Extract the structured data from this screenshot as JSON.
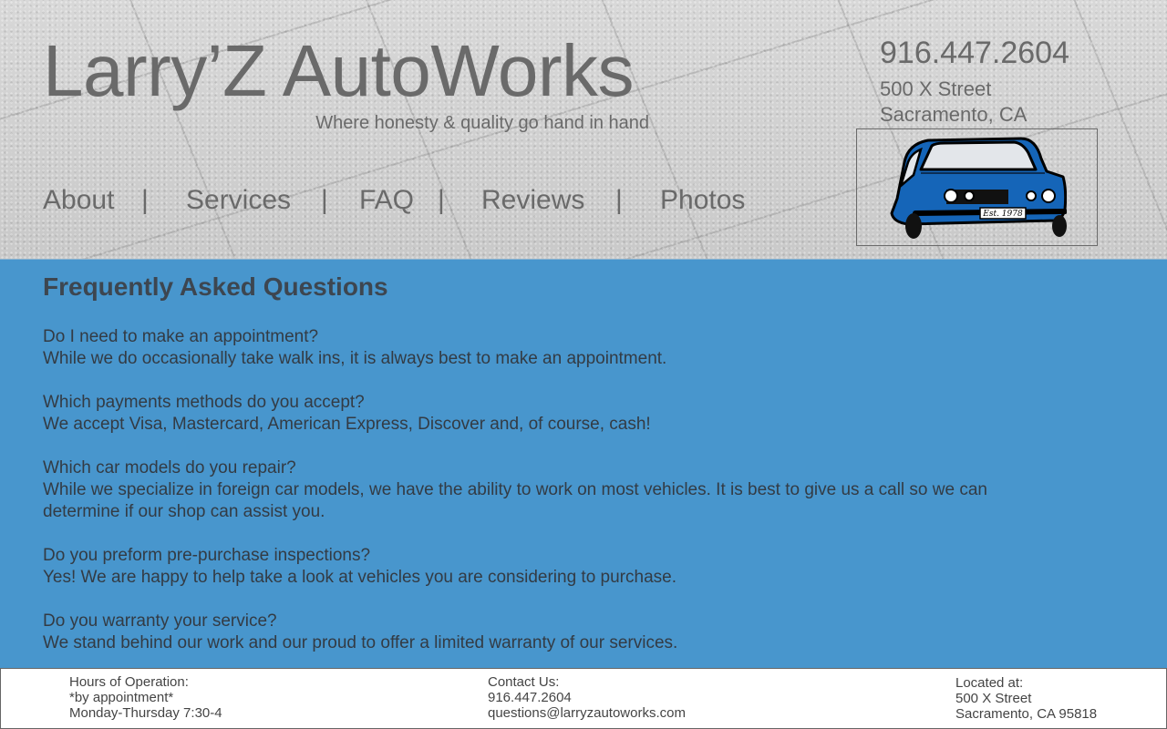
{
  "header": {
    "site_title": "Larry’Z AutoWorks",
    "tagline": "Where honesty & quality go hand in hand",
    "phone": "916.447.2604",
    "address_line1": "500 X Street",
    "address_line2": "Sacramento, CA",
    "logo_plate_text": "Est. 1978"
  },
  "nav": {
    "items": [
      {
        "label": "About"
      },
      {
        "label": "Services"
      },
      {
        "label": "FAQ"
      },
      {
        "label": "Reviews"
      },
      {
        "label": "Photos"
      }
    ],
    "separator": "|"
  },
  "faq": {
    "title": "Frequently Asked Questions",
    "items": [
      {
        "q": "Do I need to make an appointment?",
        "a": "While we do occasionally take walk ins, it is always best to make an appointment."
      },
      {
        "q": "Which payments methods do you accept?",
        "a": "We accept Visa, Mastercard, American Express, Discover and, of course, cash!"
      },
      {
        "q": "Which car models do you repair?",
        "a": "While we specialize in foreign car models, we have the ability to work on most vehicles. It is best to give us a call so we can determine if our shop can assist you."
      },
      {
        "q": "Do you preform pre-purchase inspections?",
        "a": "Yes! We are happy to help take a look at vehicles you are considering to purchase."
      },
      {
        "q": "Do you warranty your service?",
        "a": "We stand behind our work and our proud to offer a limited warranty of our services."
      }
    ]
  },
  "footer": {
    "hours_heading": "Hours of Operation:",
    "hours_note": "*by appointment*",
    "hours_days": "Monday-Thursday 7:30-4",
    "contact_heading": "Contact Us:",
    "contact_phone": "916.447.2604",
    "contact_email": "questions@larryzautoworks.com",
    "location_heading": "Located at:",
    "location_line1": "500 X Street",
    "location_line2": "Sacramento, CA 95818"
  },
  "colors": {
    "faq_background": "#4896cd",
    "car_body": "#1565b8",
    "header_text": "#6a6a6a"
  }
}
